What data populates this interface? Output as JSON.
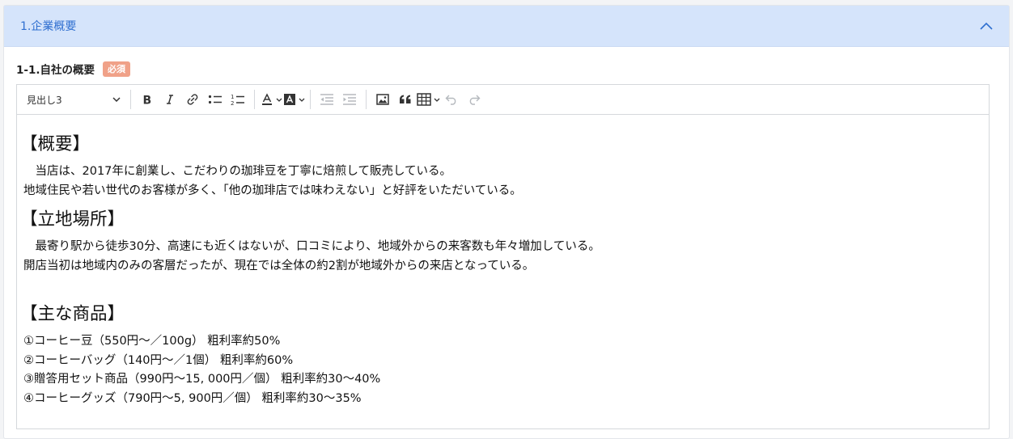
{
  "section": {
    "title": "1.企業概要"
  },
  "field": {
    "label": "1-1.自社の概要",
    "required_badge": "必須"
  },
  "editor": {
    "heading_select": "見出し3",
    "toolbar_icons": [
      "bold-icon",
      "italic-icon",
      "link-icon",
      "bulleted-list-icon",
      "numbered-list-icon",
      "font-color-icon",
      "highlight-color-icon",
      "outdent-icon",
      "indent-icon",
      "insert-image-icon",
      "blockquote-icon",
      "insert-table-icon",
      "undo-icon",
      "redo-icon"
    ],
    "content": {
      "h1": "【概要】",
      "p1": "　当店は、2017年に創業し、こだわりの珈琲豆を丁寧に焙煎して販売している。",
      "p2": "地域住民や若い世代のお客様が多く、「他の珈琲店では味わえない」と好評をいただいている。",
      "h2": "【立地場所】",
      "p3": "　最寄り駅から徒歩30分、高速にも近くはないが、口コミにより、地域外からの来客数も年々増加している。",
      "p4": "開店当初は地域内のみの客層だったが、現在では全体の約2割が地域外からの来店となっている。",
      "h3": "【主な商品】",
      "items": [
        "①コーヒー豆（550円～／100g） 粗利率約50%",
        "②コーヒーバッグ（140円～／1個） 粗利率約60%",
        "③贈答用セット商品（990円～15, 000円／個） 粗利率約30～40%",
        "④コーヒーグッズ（790円～5, 900円／個） 粗利率約30～35%"
      ]
    }
  },
  "colors": {
    "header_bg": "#d5e4fb",
    "header_text": "#2f6fd0",
    "badge_bg": "#f0a188"
  }
}
